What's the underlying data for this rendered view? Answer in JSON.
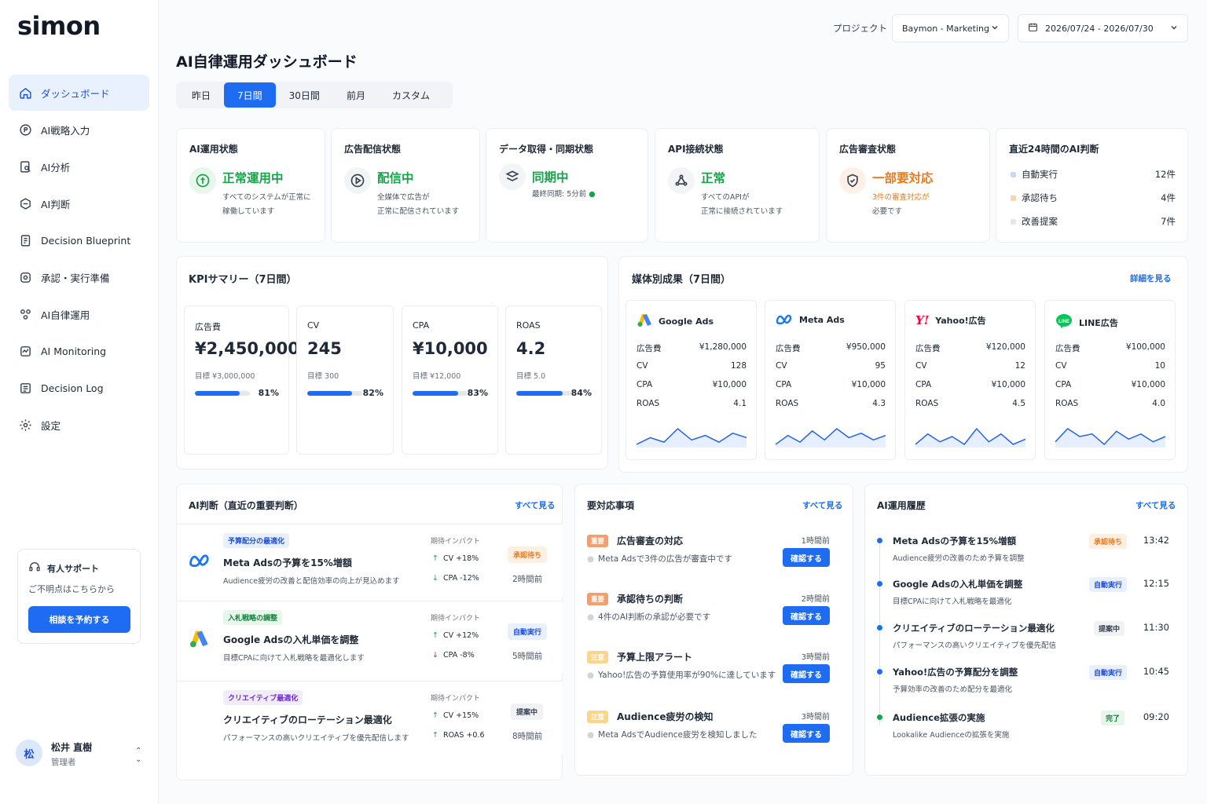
{
  "app": {
    "logo": "simon"
  },
  "sidebar": {
    "items": [
      {
        "label": "ダッシュボード",
        "icon": "home-icon"
      },
      {
        "label": "AI戦略入力",
        "icon": "strategy-icon"
      },
      {
        "label": "AI分析",
        "icon": "analytics-icon"
      },
      {
        "label": "AI判断",
        "icon": "judgment-icon"
      },
      {
        "label": "Decision Blueprint",
        "icon": "blueprint-icon"
      },
      {
        "label": "承認・実行準備",
        "icon": "approval-icon"
      },
      {
        "label": "AI自律運用",
        "icon": "autonomous-icon"
      },
      {
        "label": "AI Monitoring",
        "icon": "monitoring-icon"
      },
      {
        "label": "Decision Log",
        "icon": "log-icon"
      },
      {
        "label": "設定",
        "icon": "gear-icon"
      }
    ],
    "support": {
      "title": "有人サポート",
      "sub": "ご不明点はこちらから",
      "button": "相談を予約する"
    },
    "user": {
      "initial": "松",
      "name": "松井 直樹",
      "role": "管理者"
    }
  },
  "header": {
    "project_label": "プロジェクト",
    "project_value": "Baymon - Marketing",
    "date_range": "2026/07/24 - 2026/07/30"
  },
  "page": {
    "title": "AI自律運用ダッシュボード"
  },
  "tabs": [
    "昨日",
    "7日間",
    "30日間",
    "前月",
    "カスタム"
  ],
  "status": {
    "ops": {
      "title": "AI運用状態",
      "main": "正常運用中",
      "sub1": "すべてのシステムが正常に",
      "sub2": "稼働しています"
    },
    "delivery": {
      "title": "広告配信状態",
      "main": "配信中",
      "sub1": "全媒体で広告が",
      "sub2": "正常に配信されています"
    },
    "data": {
      "title": "データ取得・同期状態",
      "main": "同期中",
      "sub1": "最終同期: 5分前"
    },
    "api": {
      "title": "API接続状態",
      "main": "正常",
      "sub1": "すべてのAPIが",
      "sub2": "正常に接続されています"
    },
    "review": {
      "title": "広告審査状態",
      "main": "一部要対応",
      "sub1": "3件の審査対応が",
      "sub2": "必要です"
    },
    "ai24": {
      "title": "直近24時間のAI判断",
      "rows": [
        {
          "label": "自動実行",
          "value": "12件",
          "color": "#c7d7f7"
        },
        {
          "label": "承認待ち",
          "value": "4件",
          "color": "#fbd3b0"
        },
        {
          "label": "改善提案",
          "value": "7件",
          "color": "#e5e7eb"
        }
      ]
    }
  },
  "kpi": {
    "title": "KPIサマリー（7日間）",
    "items": [
      {
        "label": "広告費",
        "value": "¥2,450,000",
        "goal": "目標 ¥3,000,000",
        "pct": "81%",
        "progress": 0.81
      },
      {
        "label": "CV",
        "value": "245",
        "goal": "目標 300",
        "pct": "82%",
        "progress": 0.82
      },
      {
        "label": "CPA",
        "value": "¥10,000",
        "goal": "目標 ¥12,000",
        "pct": "83%",
        "progress": 0.83
      },
      {
        "label": "ROAS",
        "value": "4.2",
        "goal": "目標 5.0",
        "pct": "84%",
        "progress": 0.84
      }
    ]
  },
  "media": {
    "title": "媒体別成果（7日間）",
    "link": "詳細を見る",
    "items": [
      {
        "name": "Google Ads",
        "icon": "google-ads-icon",
        "rows": [
          [
            "広告費",
            "¥1,280,000"
          ],
          [
            "CV",
            "128"
          ],
          [
            "CPA",
            "¥10,000"
          ],
          [
            "ROAS",
            "4.1"
          ]
        ],
        "spark": [
          3,
          6,
          4,
          10,
          5,
          7,
          4,
          8,
          6
        ]
      },
      {
        "name": "Meta Ads",
        "icon": "meta-icon",
        "rows": [
          [
            "広告費",
            "¥950,000"
          ],
          [
            "CV",
            "95"
          ],
          [
            "CPA",
            "¥10,000"
          ],
          [
            "ROAS",
            "4.3"
          ]
        ],
        "spark": [
          3,
          7,
          4,
          9,
          5,
          10,
          6,
          8,
          5,
          7
        ]
      },
      {
        "name": "Yahoo!広告",
        "icon": "yahoo-icon",
        "rows": [
          [
            "広告費",
            "¥120,000"
          ],
          [
            "CV",
            "12"
          ],
          [
            "CPA",
            "¥10,000"
          ],
          [
            "ROAS",
            "4.5"
          ]
        ],
        "spark": [
          4,
          8,
          5,
          7,
          4,
          10,
          5,
          8,
          4,
          6
        ]
      },
      {
        "name": "LINE広告",
        "icon": "line-icon",
        "rows": [
          [
            "広告費",
            "¥100,000"
          ],
          [
            "CV",
            "10"
          ],
          [
            "CPA",
            "¥10,000"
          ],
          [
            "ROAS",
            "4.0"
          ]
        ],
        "spark": [
          4,
          9,
          6,
          7,
          3,
          8,
          5,
          7,
          4,
          6
        ]
      }
    ]
  },
  "ai_judgments": {
    "title": "AI判断（直近の重要判断）",
    "link": "すべて見る",
    "impact_label": "期待インパクト",
    "items": [
      {
        "tag": "予算配分の最適化",
        "title": "Meta Adsの予算を15%増額",
        "desc": "Audience疲労の改善と配信効率の向上が見込めます",
        "impacts": [
          "CV +18%",
          "CPA -12%"
        ],
        "status": "承認待ち",
        "time": "2時間前"
      },
      {
        "tag": "入札戦略の調整",
        "title": "Google Adsの入札単価を調整",
        "desc": "目標CPAに向けて入札戦略を最適化します",
        "impacts": [
          "CV +12%",
          "CPA -8%"
        ],
        "status": "自動実行",
        "time": "5時間前"
      },
      {
        "tag": "クリエイティブ最適化",
        "title": "クリエイティブのローテーション最適化",
        "desc": "パフォーマンスの高いクリエイティブを優先配信します",
        "impacts": [
          "CV +15%",
          "ROAS +0.6"
        ],
        "status": "提案中",
        "time": "8時間前"
      }
    ]
  },
  "todos": {
    "title": "要対応事項",
    "link": "すべて見る",
    "items": [
      {
        "pill": "重要",
        "title": "広告審査の対応",
        "desc": "Meta Adsで3件の広告が審査中です",
        "time": "1時間前",
        "button": "確認する"
      },
      {
        "pill": "重要",
        "title": "承認待ちの判断",
        "desc": "4件のAI判断の承認が必要です",
        "time": "2時間前",
        "button": "確認する"
      },
      {
        "pill": "注意",
        "title": "予算上限アラート",
        "desc": "Yahoo!広告の予算使用率が90%に達しています",
        "time": "3時間前",
        "button": "確認する"
      },
      {
        "pill": "注意",
        "title": "Audience疲労の検知",
        "desc": "Meta AdsでAudience疲労を検知しました",
        "time": "3時間前",
        "button": "確認する"
      }
    ]
  },
  "history": {
    "title": "AI運用履歴",
    "link": "すべて見る",
    "items": [
      {
        "title": "Meta Adsの予算を15%増額",
        "desc": "Audience疲労の改善のため予算を調整",
        "badge": "承認待ち",
        "time": "13:42"
      },
      {
        "title": "Google Adsの入札単価を調整",
        "desc": "目標CPAに向けて入札戦略を最適化",
        "badge": "自動実行",
        "time": "12:15"
      },
      {
        "title": "クリエイティブのローテーション最適化",
        "desc": "パフォーマンスの高いクリエイティブを優先配信",
        "badge": "提案中",
        "time": "11:30"
      },
      {
        "title": "Yahoo!広告の予算配分を調整",
        "desc": "予算効率の改善のため配分を最適化",
        "badge": "自動実行",
        "time": "10:45"
      },
      {
        "title": "Audience拡張の実施",
        "desc": "Lookalike Audienceの拡張を実施",
        "badge": "完了",
        "time": "09:20"
      }
    ]
  }
}
